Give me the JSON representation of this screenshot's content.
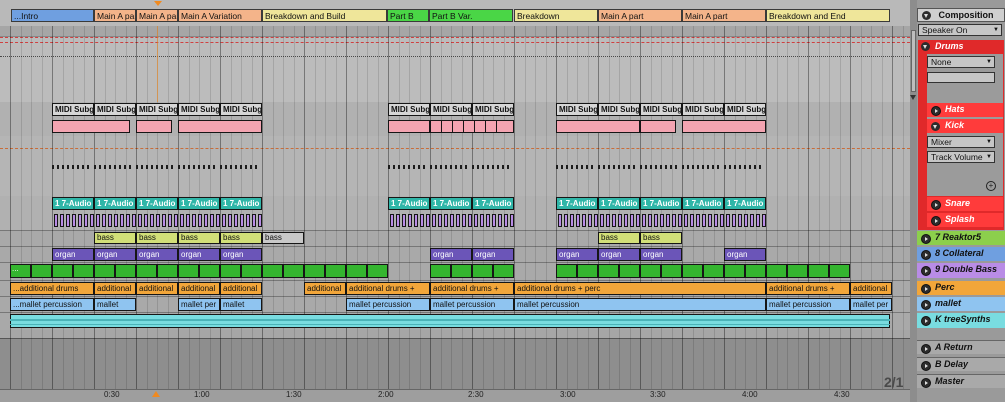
{
  "locators": [
    {
      "label": "...Intro",
      "color": "#6f9fe0"
    },
    {
      "label": "Main A part",
      "color": "#f4b48a"
    },
    {
      "label": "Main A part",
      "color": "#f4b48a"
    },
    {
      "label": "Main A Variation",
      "color": "#f4b48a"
    },
    {
      "label": "Breakdown and Build",
      "color": "#efe69a"
    },
    {
      "label": "Part B",
      "color": "#4ad646"
    },
    {
      "label": "Part B  Var.",
      "color": "#4ad646"
    },
    {
      "label": "Breakdown",
      "color": "#efe69a"
    },
    {
      "label": "Main A part",
      "color": "#f4b48a"
    },
    {
      "label": "Main A part",
      "color": "#f4b48a"
    },
    {
      "label": "Breakdown and End",
      "color": "#efe69a"
    }
  ],
  "clip_rows": {
    "midi_sub": [
      "MIDI Subgroup",
      "MIDI Subgroup",
      "MIDI Subgroup",
      "MIDI Subgroup",
      "MIDI Subgroup",
      "MIDI Subgroup",
      "MIDI Subgroup",
      "MIDI Subgroup",
      "MIDI Subgroup",
      "MIDI Subgroup",
      "MIDI Subgroup",
      "MIDI Subgroup",
      "MIDI Subgroup"
    ],
    "audio": [
      "1 7-Audio",
      "1 7-Audio",
      "1 7-Audio",
      "1 7-Audio",
      "1 7-Audio",
      "1 7-Audio",
      "1 7-Audio",
      "1 7-Audio",
      "1 7-Audio",
      "1 7-Audio",
      "1 7-Audio",
      "1 7-Audio",
      "1 7-Audio"
    ],
    "bass": [
      "bass",
      "bass",
      "bass",
      "bass",
      "bass",
      "bass",
      "bass"
    ],
    "organ": [
      "organ",
      "organ",
      "organ",
      "organ",
      "organ",
      "organ",
      "organ",
      "organ",
      "organ",
      "organ",
      "organ"
    ],
    "green_start": "...",
    "perc": [
      "...additional drums",
      "additional",
      "additional",
      "additional",
      "additional",
      "additional",
      "additional drums +",
      "additional drums +",
      "additional drums + perc",
      "additional drums +",
      "additional"
    ],
    "mallet": [
      "...mallet percussion",
      "mallet",
      "mallet per",
      "mallet",
      "mallet percussion",
      "mallet percussion",
      "mallet percussion",
      "mallet percussion",
      "mallet per"
    ]
  },
  "time_ruler": [
    "0:30",
    "1:00",
    "1:30",
    "2:00",
    "2:30",
    "3:00",
    "3:30",
    "4:00",
    "4:30"
  ],
  "page_indicator": "2/1",
  "panel": {
    "composition": "Composition",
    "speaker_select": "Speaker On",
    "drums": "Drums",
    "none_select": "None",
    "hats": "Hats",
    "kick": "Kick",
    "mixer_select": "Mixer",
    "track_volume_select": "Track Volume",
    "snare": "Snare",
    "splash": "Splash",
    "reaktor": "7 Reaktor5",
    "collateral": "8 Collateral",
    "double_bass": "9 Double Bass",
    "perc": "Perc",
    "mallet": "mallet",
    "treesynths": "K treeSynths",
    "a_return": "A Return",
    "b_delay": "B Delay",
    "master": "Master"
  },
  "colors": {
    "drums_group": "#e0292a",
    "hats": "#ff3b3b",
    "reaktor": "#8ccf4c",
    "collateral": "#6f9fe0",
    "double_bass": "#b98ce6",
    "perc": "#f2a63a",
    "mallet": "#8fc4f0",
    "treesynths": "#79dce0",
    "midi_clip": "#f3a4b1",
    "audio_clip": "#2fb6a8",
    "organ_clip": "#6b55b8",
    "bass_clip": "#d2df78",
    "green_clip": "#34b52f"
  }
}
